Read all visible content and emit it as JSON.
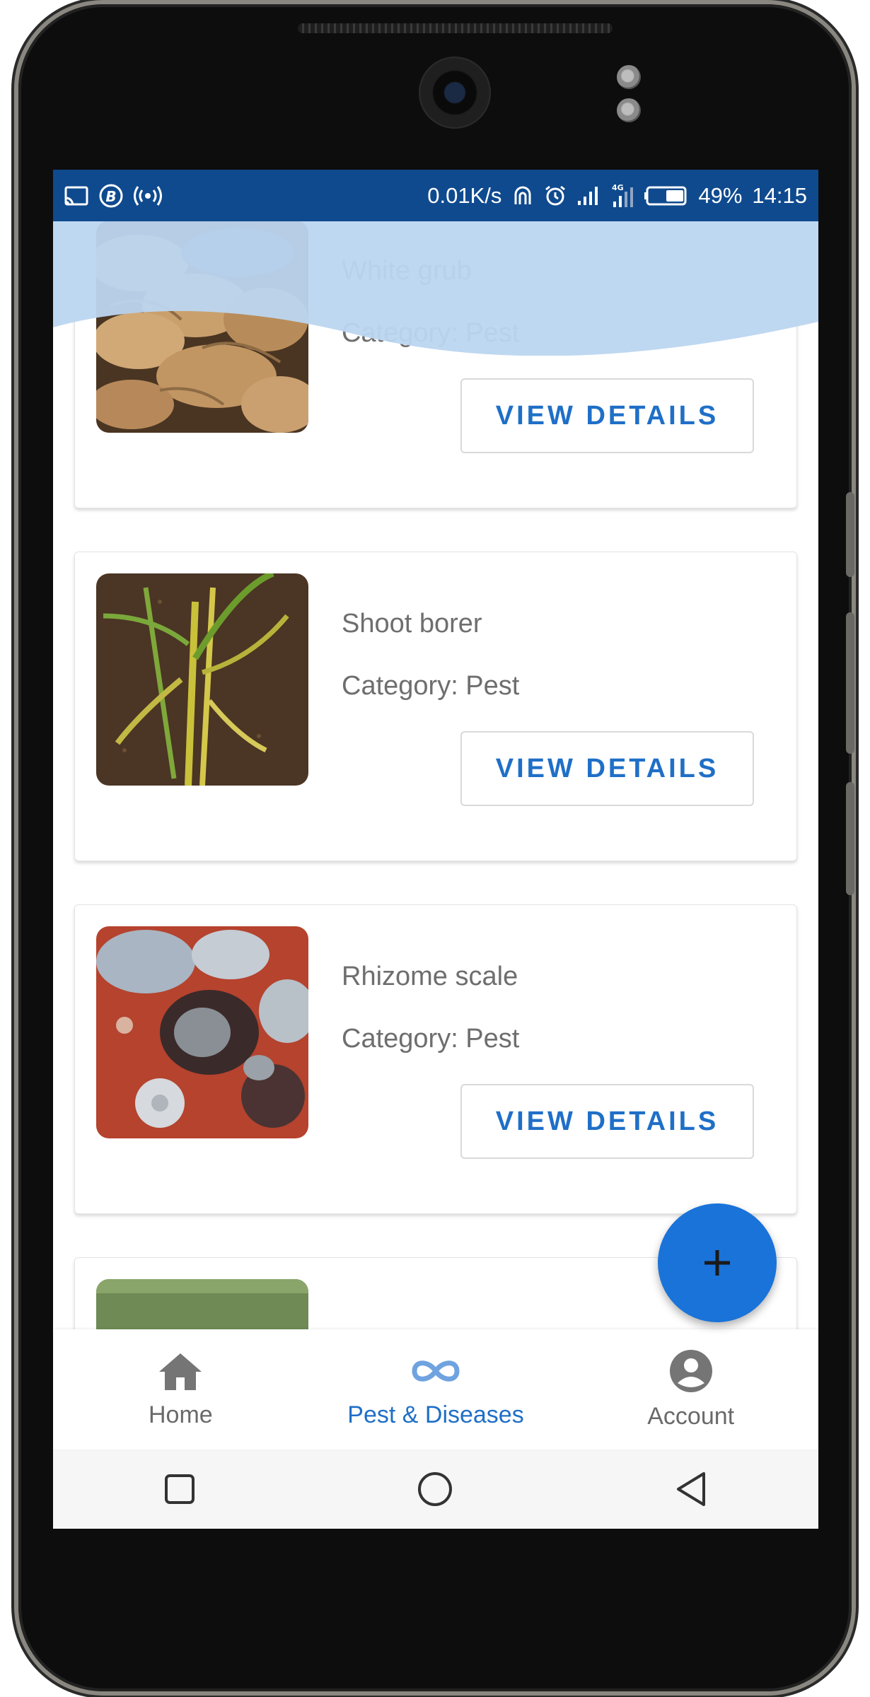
{
  "status_bar": {
    "network_speed": "0.01K/s",
    "network_type": "4G",
    "battery": "49%",
    "time": "14:15"
  },
  "items": [
    {
      "title": "White grub",
      "category": "Category: Pest",
      "button": "VIEW DETAILS",
      "image": "ginger-rhizomes"
    },
    {
      "title": "Shoot borer",
      "category": "Category: Pest",
      "button": "VIEW DETAILS",
      "image": "yellowing-ginger-shoots"
    },
    {
      "title": "Rhizome scale",
      "category": "Category: Pest",
      "button": "VIEW DETAILS",
      "image": "scale-infested-rhizome"
    }
  ],
  "fab": {
    "icon": "plus-icon"
  },
  "bottom_nav": {
    "items": [
      {
        "label": "Home",
        "icon": "home-icon",
        "active": false
      },
      {
        "label": "Pest & Diseases",
        "icon": "infinity-icon",
        "active": true
      },
      {
        "label": "Account",
        "icon": "account-circle-icon",
        "active": false
      }
    ]
  },
  "colors": {
    "status_bar": "#0f4a8e",
    "accent": "#1f6fc7",
    "fab": "#1a73d9",
    "wave": "#bcd6f0",
    "inactive": "#6a6a6a"
  }
}
